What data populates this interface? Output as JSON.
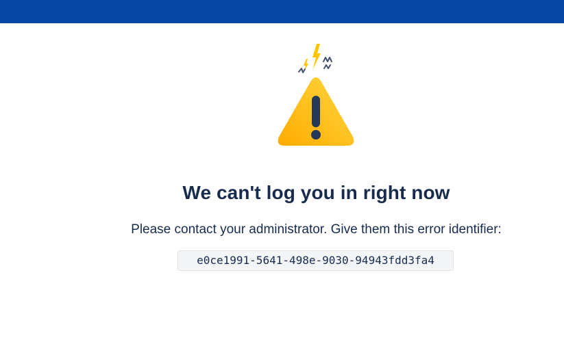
{
  "colors": {
    "top_bar": "#0747a6",
    "text_primary": "#172b4d",
    "warning_yellow": "#ffc400",
    "warning_dark": "#253858"
  },
  "illustration": {
    "icon": "warning-triangle-icon"
  },
  "error_page": {
    "title": "We can't log you in right now",
    "message": "Please contact your administrator. Give them this error identifier:",
    "error_identifier": "e0ce1991-5641-498e-9030-94943fdd3fa4"
  }
}
